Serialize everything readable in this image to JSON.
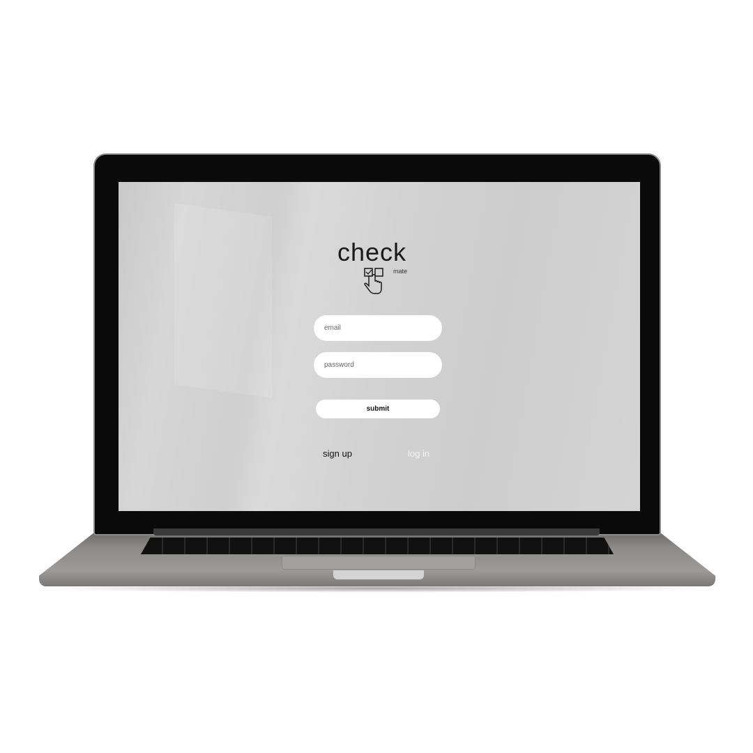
{
  "brand": {
    "name": "check",
    "sub": "mate",
    "logo_icon": "checkbox-hand-pointer-icon"
  },
  "form": {
    "email_placeholder": "email",
    "password_placeholder": "password",
    "submit_label": "submit"
  },
  "links": {
    "sign_up": "sign up",
    "log_in": "log in"
  }
}
